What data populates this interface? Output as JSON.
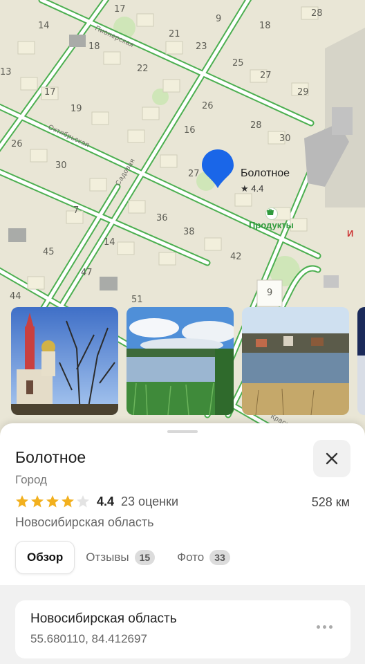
{
  "map": {
    "house_numbers": [
      "17",
      "9",
      "18",
      "28",
      "14",
      "21",
      "18",
      "23",
      "22",
      "25",
      "27",
      "13",
      "17",
      "29",
      "19",
      "26",
      "28",
      "16",
      "30",
      "26",
      "30",
      "27",
      "7",
      "36",
      "38",
      "45",
      "14",
      "42",
      "47",
      "44",
      "51",
      "9"
    ],
    "streets": [
      "Пионерская",
      "Октябрьская",
      "Садовая",
      "Красная"
    ],
    "place": {
      "name": "Болотное",
      "rating": "★ 4.4"
    },
    "poi": {
      "label": "Продукты",
      "right_label": "И"
    }
  },
  "photos": [
    "church-photo",
    "lake-photo",
    "village-lake-photo",
    "partial-photo"
  ],
  "sheet": {
    "title": "Болотное",
    "subtitle": "Город",
    "rating_value": "4.4",
    "rating_count": "23 оценки",
    "stars_filled": 4,
    "stars_total": 5,
    "distance": "528 км",
    "region": "Новосибирская область",
    "tabs": [
      {
        "label": "Обзор",
        "badge": ""
      },
      {
        "label": "Отзывы",
        "badge": "15"
      },
      {
        "label": "Фото",
        "badge": "33"
      }
    ],
    "card": {
      "title": "Новосибирская область",
      "coords": "55.680110, 84.412697"
    }
  },
  "colors": {
    "star": "#f2b01e",
    "road": "#4caf50",
    "pin": "#1a66e8",
    "map_bg": "#e9e6d6"
  }
}
